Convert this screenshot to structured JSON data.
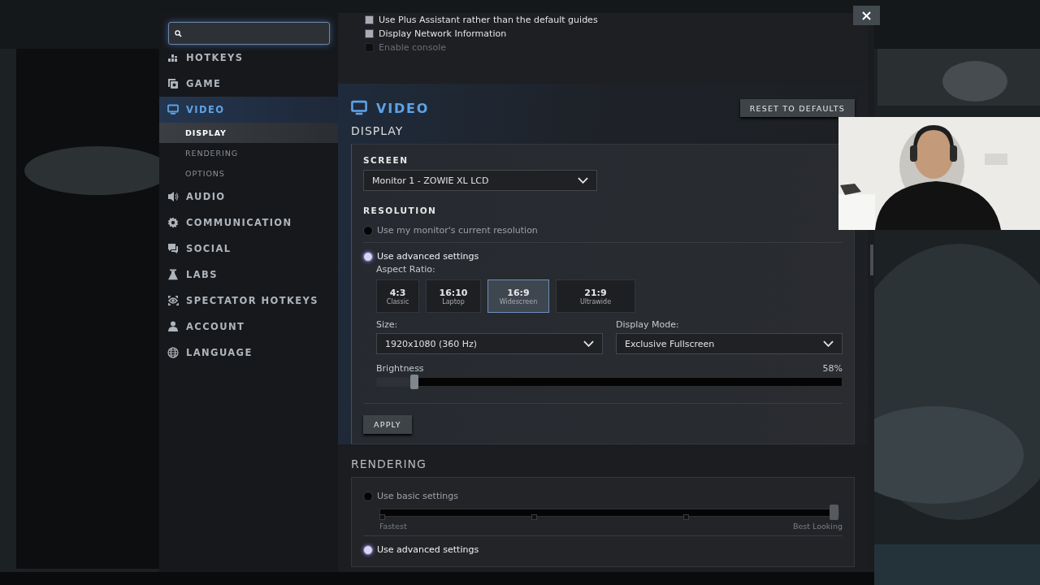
{
  "sidebar": {
    "items": [
      {
        "label": "HOTKEYS",
        "selected": false
      },
      {
        "label": "GAME",
        "selected": false
      },
      {
        "label": "VIDEO",
        "selected": true,
        "children": [
          {
            "label": "DISPLAY",
            "selected": true
          },
          {
            "label": "RENDERING",
            "selected": false
          },
          {
            "label": "OPTIONS",
            "selected": false
          }
        ]
      },
      {
        "label": "AUDIO",
        "selected": false
      },
      {
        "label": "COMMUNICATION",
        "selected": false
      },
      {
        "label": "SOCIAL",
        "selected": false
      },
      {
        "label": "LABS",
        "selected": false
      },
      {
        "label": "SPECTATOR HOTKEYS",
        "selected": false
      },
      {
        "label": "ACCOUNT",
        "selected": false
      },
      {
        "label": "LANGUAGE",
        "selected": false
      }
    ]
  },
  "options": [
    {
      "label": "Use Plus Assistant rather than the default guides",
      "checked": true,
      "disabled": false
    },
    {
      "label": "Display Network Information",
      "checked": true,
      "disabled": false
    },
    {
      "label": "Enable console",
      "checked": false,
      "disabled": true
    }
  ],
  "video": {
    "title": "VIDEO",
    "reset_button": "RESET TO DEFAULTS",
    "section": "DISPLAY",
    "screen": {
      "heading": "SCREEN",
      "value": "Monitor 1 - ZOWIE XL LCD"
    },
    "resolution": {
      "heading": "RESOLUTION",
      "modes": [
        {
          "label": "Use my monitor's current resolution",
          "selected": false
        },
        {
          "label": "Use advanced settings",
          "selected": true
        }
      ],
      "aspect_label": "Aspect Ratio:",
      "aspects": [
        {
          "ratio": "4:3",
          "name": "Classic",
          "selected": false
        },
        {
          "ratio": "16:10",
          "name": "Laptop",
          "selected": false
        },
        {
          "ratio": "16:9",
          "name": "Widescreen",
          "selected": true
        },
        {
          "ratio": "21:9",
          "name": "Ultrawide",
          "selected": false
        }
      ],
      "size": {
        "label": "Size:",
        "value": "1920x1080 (360 Hz)"
      },
      "display_mode": {
        "label": "Display Mode:",
        "value": "Exclusive Fullscreen"
      },
      "brightness": {
        "label": "Brightness",
        "reading": "58%",
        "level": 0.08
      }
    },
    "apply_button": "APPLY"
  },
  "rendering": {
    "title": "RENDERING",
    "modes": [
      {
        "label": "Use basic settings",
        "selected": false
      },
      {
        "label": "Use advanced settings",
        "selected": true
      }
    ],
    "quality": {
      "level": 1,
      "min_label": "Fastest",
      "max_label": "Best Looking"
    }
  }
}
